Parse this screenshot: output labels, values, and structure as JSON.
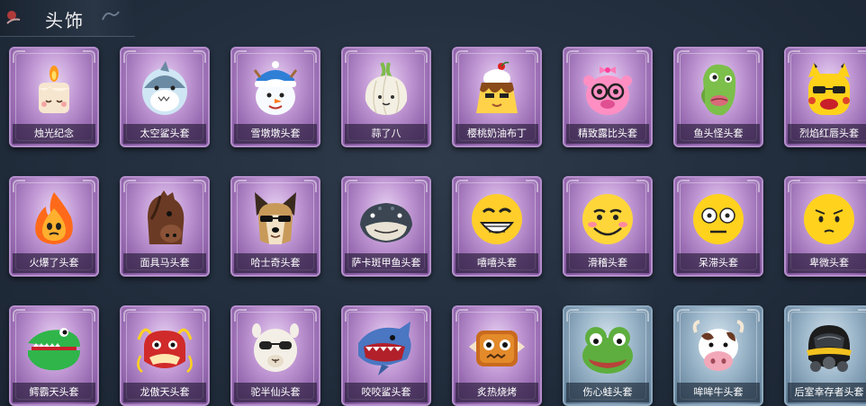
{
  "header": {
    "title": "头饰"
  },
  "items": [
    {
      "label": "烛光纪念",
      "theme": "purple",
      "icon": "candle-icon"
    },
    {
      "label": "太空鲨头套",
      "theme": "purple",
      "icon": "space-shark-icon"
    },
    {
      "label": "雪墩墩头套",
      "theme": "purple",
      "icon": "snowman-icon"
    },
    {
      "label": "蒜了八",
      "theme": "purple",
      "icon": "garlic-icon"
    },
    {
      "label": "樱桃奶油布丁",
      "theme": "purple",
      "icon": "pudding-icon"
    },
    {
      "label": "精致露比头套",
      "theme": "purple",
      "icon": "pink-pig-icon"
    },
    {
      "label": "鱼头怪头套",
      "theme": "purple",
      "icon": "fish-monster-icon"
    },
    {
      "label": "烈焰红唇头套",
      "theme": "purple",
      "icon": "yellow-lips-icon"
    },
    {
      "label": "火爆了头套",
      "theme": "purple",
      "icon": "fire-icon"
    },
    {
      "label": "面具马头套",
      "theme": "purple",
      "icon": "horse-icon"
    },
    {
      "label": "哈士奇头套",
      "theme": "purple",
      "icon": "husky-icon"
    },
    {
      "label": "萨卡斑甲鱼头套",
      "theme": "purple",
      "icon": "catfish-icon"
    },
    {
      "label": "嘻嘻头套",
      "theme": "purple",
      "icon": "grin-emoji-icon"
    },
    {
      "label": "滑稽头套",
      "theme": "purple",
      "icon": "funny-emoji-icon"
    },
    {
      "label": "呆滞头套",
      "theme": "purple",
      "icon": "dazed-emoji-icon"
    },
    {
      "label": "卑微头套",
      "theme": "purple",
      "icon": "humble-emoji-icon"
    },
    {
      "label": "鳄霸天头套",
      "theme": "purple",
      "icon": "crocodile-icon"
    },
    {
      "label": "龙傲天头套",
      "theme": "purple",
      "icon": "dragon-icon"
    },
    {
      "label": "驼半仙头套",
      "theme": "purple",
      "icon": "alpaca-icon"
    },
    {
      "label": "咬咬鲨头套",
      "theme": "purple",
      "icon": "biting-shark-icon"
    },
    {
      "label": "炙热烧烤",
      "theme": "purple",
      "icon": "bbq-icon"
    },
    {
      "label": "伤心蛙头套",
      "theme": "blue",
      "icon": "sad-frog-icon"
    },
    {
      "label": "哞哞牛头套",
      "theme": "blue",
      "icon": "cow-icon"
    },
    {
      "label": "后室幸存者头套",
      "theme": "blue",
      "icon": "gas-mask-icon"
    }
  ]
}
